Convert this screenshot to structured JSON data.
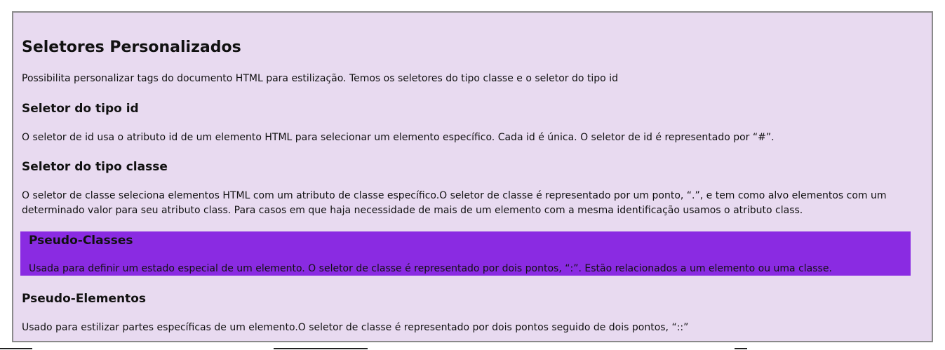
{
  "colors": {
    "panel_background": "#e8daf0",
    "panel_border": "#8a8a8a",
    "highlight_background": "#8a2be2"
  },
  "title": "Seletores Personalizados",
  "intro": "Possibilita personalizar tags do documento HTML para estilização. Temos os seletores do tipo classe e o seletor do tipo id",
  "sections": [
    {
      "heading": "Seletor do tipo id",
      "text": "O seletor de id usa o atributo id de um elemento HTML para selecionar um elemento específico. Cada id é única. O seletor de id é representado por “#”."
    },
    {
      "heading": "Seletor do tipo classe",
      "text": "O seletor de classe seleciona elementos HTML com um atributo de classe específico.O seletor de classe é representado por um ponto, “.”, e tem como alvo elementos com um determinado valor para seu atributo class. Para casos em que haja necessidade de mais de um elemento com a mesma identificação usamos o atributo class."
    },
    {
      "heading": "Pseudo-Classes",
      "text": "Usada para definir um estado especial de um elemento. O seletor de classe é representado por dois pontos, “:”. Estão relacionados a um elemento ou uma classe."
    },
    {
      "heading": "Pseudo-Elementos",
      "text": "Usado para estilizar partes específicas de um elemento.O seletor de classe é representado por dois pontos seguido de dois pontos, “::”"
    }
  ]
}
